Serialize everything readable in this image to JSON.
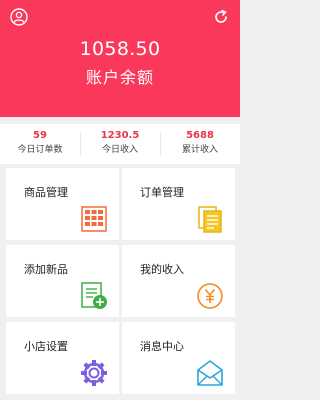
{
  "header": {
    "balance": "1058.50",
    "balance_label": "账户余额",
    "left_icon": "user-icon",
    "right_icon": "refresh-icon"
  },
  "stats": [
    {
      "value": "59",
      "label": "今日订单数"
    },
    {
      "value": "1230.5",
      "label": "今日收入"
    },
    {
      "value": "5688",
      "label": "累计收入"
    }
  ],
  "menu": [
    {
      "label": "商品管理",
      "icon": "product-grid-icon"
    },
    {
      "label": "订单管理",
      "icon": "order-documents-icon"
    },
    {
      "label": "添加新品",
      "icon": "add-product-icon"
    },
    {
      "label": "我的收入",
      "icon": "yen-coin-icon"
    },
    {
      "label": "小店设置",
      "icon": "settings-gear-icon"
    },
    {
      "label": "消息中心",
      "icon": "message-envelope-icon"
    }
  ],
  "colors": {
    "brand": "#f9385c",
    "stat_value": "#e8344c"
  }
}
